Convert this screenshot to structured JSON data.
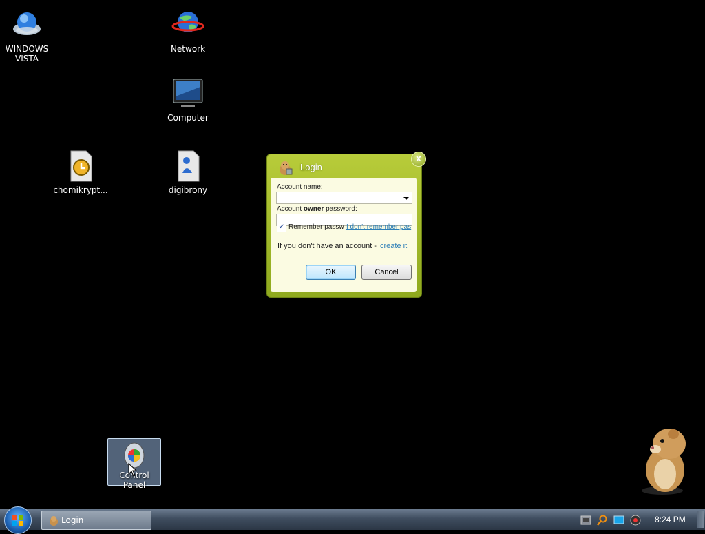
{
  "desktop": {
    "icons": [
      {
        "label_line1": "WINDOWS",
        "label_line2": "VISTA",
        "icon": "windows-vista-icon"
      },
      {
        "label": "Network",
        "icon": "network-globe-icon"
      },
      {
        "label": "Computer",
        "icon": "computer-monitor-icon"
      },
      {
        "label": "chomikrypt...",
        "icon": "clock-file-icon"
      },
      {
        "label": "digibrony",
        "icon": "digibrony-shortcut-icon"
      },
      {
        "label": "Control Panel",
        "icon": "control-panel-icon",
        "selected": true
      }
    ],
    "mascot": "hamster-mascot"
  },
  "dialog": {
    "title": "Login",
    "close_label": "x",
    "account_name_label": "Account name:",
    "account_name_value": "",
    "password_label_prefix": "Account ",
    "password_label_bold": "owner",
    "password_label_suffix": " password:",
    "password_value": "",
    "remember_label": "Remember passw",
    "remember_checked": true,
    "forgot_link": "I don't remember pas",
    "no_account_text": "If you don't have an account - ",
    "create_link": "create it",
    "ok_label": "OK",
    "cancel_label": "Cancel"
  },
  "taskbar": {
    "task_label": "Login",
    "clock": "8:24 PM"
  },
  "colors": {
    "dialog_frame": "#a7bd2a",
    "dialog_panel": "#fbfbe2",
    "link": "#2e7fb8",
    "taskbar": "#3f4d5f"
  }
}
